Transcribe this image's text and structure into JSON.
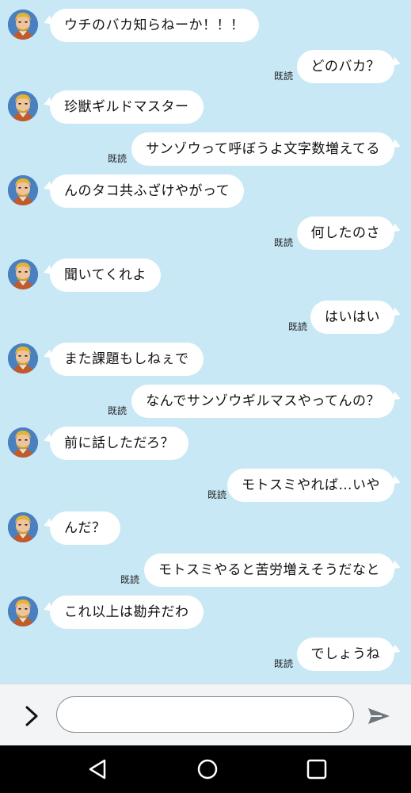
{
  "conversation": {
    "read_label": "既読",
    "messages": [
      {
        "side": "in",
        "text": "ウチのバカ知らねーか！！！"
      },
      {
        "side": "out",
        "text": "どのバカ？"
      },
      {
        "side": "in",
        "text": "珍獣ギルドマスター"
      },
      {
        "side": "out",
        "text": "サンゾウって呼ぼうよ文字数増えてる"
      },
      {
        "side": "in",
        "text": "んのタコ共ふざけやがって"
      },
      {
        "side": "out",
        "text": "何したのさ"
      },
      {
        "side": "in",
        "text": "聞いてくれよ"
      },
      {
        "side": "out",
        "text": "はいはい"
      },
      {
        "side": "in",
        "text": "また課題もしねぇで"
      },
      {
        "side": "out",
        "text": "なんでサンゾウギルマスやってんの？"
      },
      {
        "side": "in",
        "text": "前に話しただろ？"
      },
      {
        "side": "out",
        "text": "モトスミやれば…いや"
      },
      {
        "side": "in",
        "text": "んだ？"
      },
      {
        "side": "out",
        "text": "モトスミやると苦労増えそうだなと"
      },
      {
        "side": "in",
        "text": "これ以上は勘弁だわ"
      },
      {
        "side": "out",
        "text": "でしょうね"
      }
    ]
  },
  "input": {
    "value": "",
    "placeholder": ""
  },
  "icons": {
    "expand": "chevron-right-icon",
    "send": "send-icon",
    "nav_back": "triangle-back-icon",
    "nav_home": "circle-home-icon",
    "nav_recents": "square-recents-icon"
  },
  "colors": {
    "chat_background": "#c8e8f5",
    "bubble": "#ffffff",
    "input_bar": "#f3f4f6",
    "nav_bar": "#000000"
  }
}
